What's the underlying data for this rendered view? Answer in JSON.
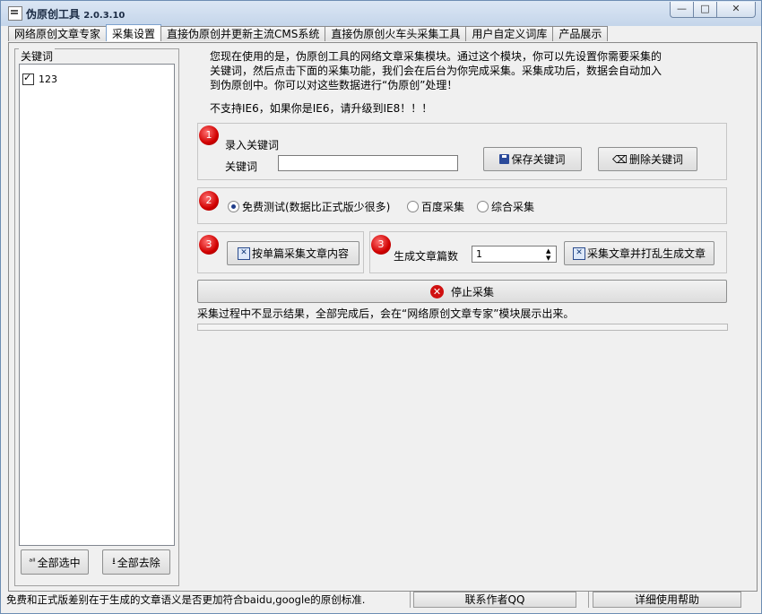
{
  "app": {
    "title": "伪原创工具",
    "version": "2.0.3.10",
    "window_buttons": {
      "minimize": "—",
      "maximize": "□",
      "close": "✕"
    }
  },
  "tabs": [
    {
      "label": "网络原创文章专家",
      "active": false
    },
    {
      "label": "采集设置",
      "active": true
    },
    {
      "label": "直接伪原创并更新主流CMS系统",
      "active": false
    },
    {
      "label": "直接伪原创火车头采集工具",
      "active": false
    },
    {
      "label": "用户自定义词库",
      "active": false
    },
    {
      "label": "产品展示",
      "active": false
    }
  ],
  "keywords": {
    "legend": "关键词",
    "items": [
      {
        "label": "123",
        "checked": true
      }
    ],
    "select_all": "全部选中",
    "clear_all": "全部去除",
    "select_all_icon": "all-select-icon",
    "clear_all_icon": "clear-down-icon"
  },
  "intro": {
    "lines": [
      "您现在使用的是，伪原创工具的网络文章采集模块。通过这个模块，你可以先设置你需要采集的",
      "关键词，然后点击下面的采集功能，我们会在后台为你完成采集。采集成功后，数据会自动加入",
      "到伪原创中。你可以对这些数据进行“伪原创”处理！"
    ],
    "warning": "不支持IE6，如果你是IE6，请升级到IE8！！！"
  },
  "step1": {
    "badge": "1",
    "title": "录入关键词",
    "field_label": "关键词",
    "field_value": "",
    "save_button": "保存关键词",
    "delete_button": "删除关键词"
  },
  "step2": {
    "badge": "2",
    "options": [
      {
        "label": "免费测试(数据比正式版少很多)",
        "selected": true
      },
      {
        "label": "百度采集",
        "selected": false
      },
      {
        "label": "综合采集",
        "selected": false
      }
    ]
  },
  "step3a": {
    "badge": "3",
    "button": "按单篇采集文章内容"
  },
  "step3b": {
    "badge": "3",
    "count_label": "生成文章篇数",
    "count_value": "1",
    "button": "采集文章并打乱生成文章"
  },
  "stop_button": "停止采集",
  "note": "采集过程中不显示结果，全部完成后，会在“网络原创文章专家”模块展示出来。",
  "progress": {
    "value": 0
  },
  "statusbar": {
    "text": "免费和正式版差别在于生成的文章语义是否更加符合baidu,google的原创标准.",
    "contact": "联系作者QQ",
    "help": "详细使用帮助"
  },
  "colors": {
    "title_bar": "#c9d8ec",
    "active_tab_border": "#7da2ce",
    "step_badge": "#d00000"
  }
}
